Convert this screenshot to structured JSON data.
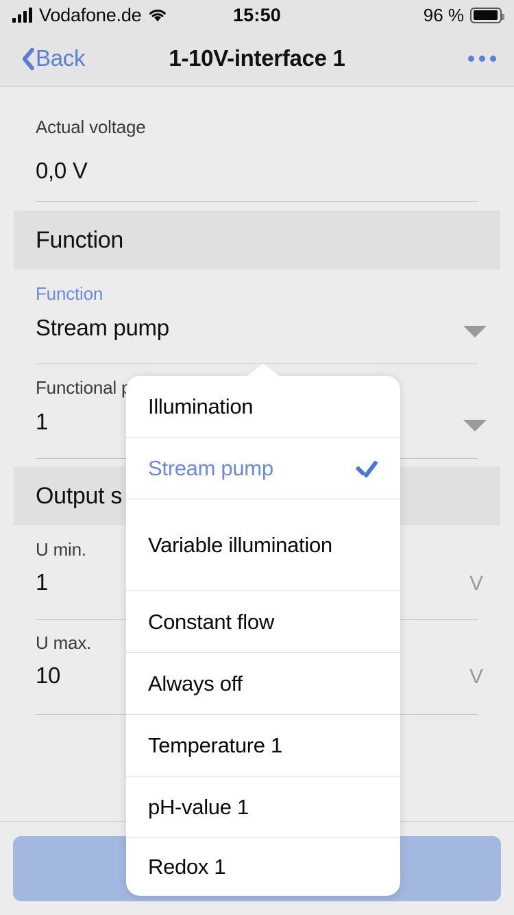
{
  "status_bar": {
    "carrier": "Vodafone.de",
    "time": "15:50",
    "battery_percent": "96 %",
    "signal_icon": "signal-bars-icon",
    "wifi_icon": "wifi-icon",
    "battery_icon": "battery-full-icon"
  },
  "nav_bar": {
    "back_label": "Back",
    "title": "1-10V-interface 1",
    "more_icon": "more-horizontal-icon"
  },
  "content": {
    "actual_voltage": {
      "label": "Actual voltage",
      "value": "0,0 V"
    },
    "section_function": {
      "title": "Function"
    },
    "function_field": {
      "label": "Function",
      "value": "Stream pump",
      "dropdown_icon": "chevron-down-icon"
    },
    "functional_p_field": {
      "label": "Functional p",
      "value": "1",
      "dropdown_icon": "chevron-down-icon"
    },
    "section_output": {
      "title": "Output s"
    },
    "u_min": {
      "label": "U min.",
      "value": "1",
      "unit": "V"
    },
    "u_max": {
      "label": "U max.",
      "value": "10",
      "unit": "V"
    }
  },
  "bottom": {
    "save_label": ""
  },
  "function_popup": {
    "selected_index": 1,
    "check_icon": "checkmark-icon",
    "items": [
      {
        "label": "Illumination",
        "selected": false
      },
      {
        "label": "Stream pump",
        "selected": true
      },
      {
        "label": "Variable illumination",
        "selected": false
      },
      {
        "label": "Constant flow",
        "selected": false
      },
      {
        "label": "Always off",
        "selected": false
      },
      {
        "label": "Temperature 1",
        "selected": false
      },
      {
        "label": "pH-value 1",
        "selected": false
      },
      {
        "label": "Redox 1",
        "selected": false
      }
    ]
  },
  "colors": {
    "accent_blue": "#5b7fd4",
    "label_blue": "#6b8ada",
    "check_blue": "#4a77d4",
    "button_blue": "#a3b8e0",
    "page_bg": "#ececec",
    "bar_bg": "#e4e4e4",
    "section_bg": "#e0e0e0",
    "rule": "#c4c4c4",
    "unit_gray": "#9a9a9a"
  }
}
